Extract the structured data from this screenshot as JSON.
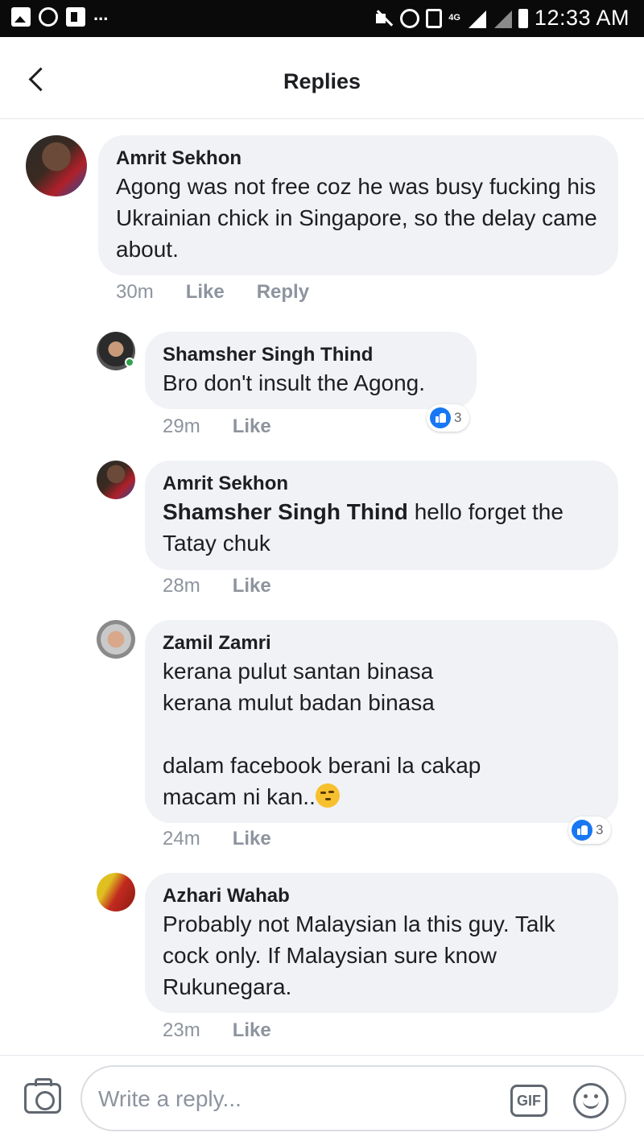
{
  "status_bar": {
    "time": "12:33 AM",
    "network": "4G",
    "overflow": "...",
    "icons": [
      "gallery-icon",
      "whatsapp-icon",
      "flipboard-icon",
      "mute-icon",
      "alarm-icon",
      "data-saver-icon",
      "signal-icon",
      "battery-icon"
    ]
  },
  "header": {
    "title": "Replies",
    "back_icon": "chevron-left-icon"
  },
  "comments": [
    {
      "author": "Amrit Sekhon",
      "text": "Agong was not free coz he was busy fucking his Ukrainian chick in Singapore, so the delay came about.",
      "time": "30m",
      "like_label": "Like",
      "reply_label": "Reply"
    },
    {
      "author": "Shamsher Singh Thind",
      "text": "Bro don't insult the Agong.",
      "time": "29m",
      "like_label": "Like",
      "reactions": "3"
    },
    {
      "author": "Amrit Sekhon",
      "mention": "Shamsher Singh Thind",
      "text": " hello forget the Tatay chuk",
      "time": "28m",
      "like_label": "Like"
    },
    {
      "author": "Zamil Zamri",
      "text": "kerana pulut santan binasa\nkerana mulut badan binasa\n\ndalam facebook berani la cakap\nmacam ni kan..",
      "time": "24m",
      "like_label": "Like",
      "reactions": "3"
    },
    {
      "author": "Azhari Wahab",
      "text": "Probably not Malaysian la this guy. Talk cock only. If Malaysian sure know Rukunegara.",
      "time": "23m",
      "like_label": "Like"
    }
  ],
  "composer": {
    "placeholder": "Write a reply...",
    "gif_label": "GIF"
  },
  "colors": {
    "bubble": "#f0f2f5",
    "like_blue": "#1877f2",
    "meta_gray": "#8d949e",
    "online_green": "#31a24c"
  }
}
